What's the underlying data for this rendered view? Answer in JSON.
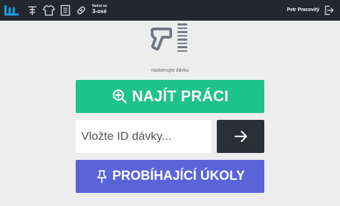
{
  "header": {
    "icons": [
      "logo-icon",
      "cut-plan-icon",
      "shirt-icon",
      "list-icon",
      "link-icon"
    ],
    "shift_label": "Noční na",
    "shift_value": "3-osé",
    "user_name": "Petr Pracovitý",
    "logout_icon": "logout-icon"
  },
  "main": {
    "scan_hint": "naskenujte dávku",
    "find_work_label": "NAJÍT PRÁCI",
    "batch_input": {
      "placeholder": "Vložte ID dávky...",
      "value": ""
    },
    "submit_icon": "arrow-right-icon",
    "ongoing_tasks_label": "PROBÍHAJÍCÍ ÚKOLY"
  },
  "colors": {
    "topbar": "#24272d",
    "accent_blue": "#1aa3e8",
    "find_green": "#1ec28b",
    "tasks_purple": "#5a63d8",
    "dark_button": "#2a2e35"
  }
}
